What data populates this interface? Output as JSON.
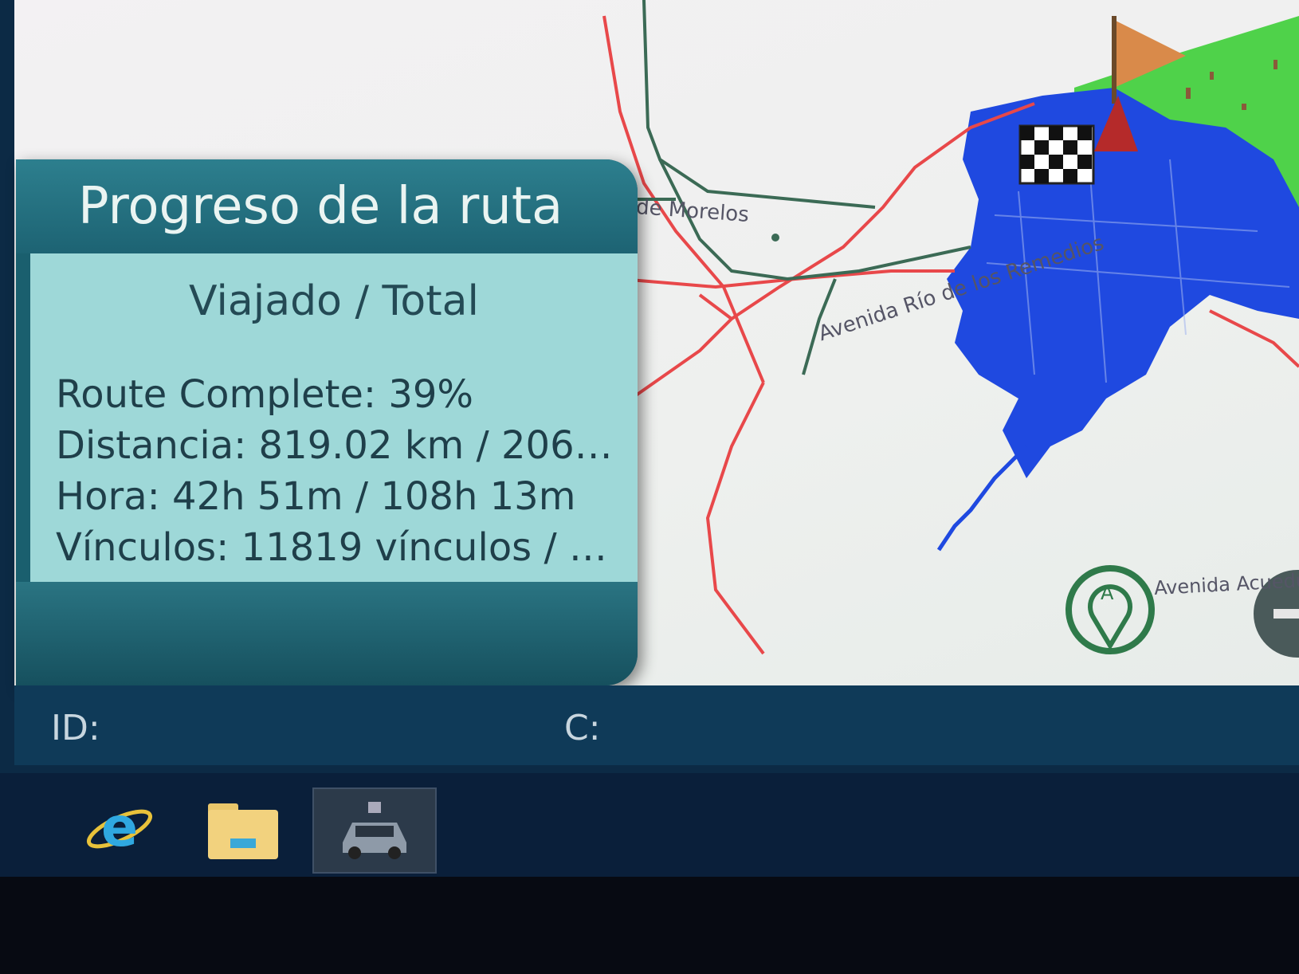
{
  "map": {
    "labels": {
      "morelos": "de Morelos",
      "avenida_rio": "Avenida Río de los Remedios",
      "acueducto": "Avenida Acueducto"
    },
    "marker_label": "A"
  },
  "route_panel": {
    "title": "Progreso de la ruta",
    "subtitle": "Viajado / Total",
    "stats": {
      "complete": "Route Complete: 39%",
      "distance": "Distancia: 819.02 km / 206…",
      "time": "Hora: 42h 51m / 108h 13m",
      "links": "Vínculos: 11819 vínculos / …"
    },
    "progress_percent": 39
  },
  "status_bar": {
    "id_label": "ID:",
    "c_label": "C:"
  },
  "taskbar": {
    "items": [
      {
        "name": "internet-explorer",
        "icon": "ie-icon"
      },
      {
        "name": "file-explorer",
        "icon": "folder-icon"
      },
      {
        "name": "vehicle-app",
        "icon": "car-icon"
      }
    ]
  },
  "colors": {
    "route_line": "#e8484a",
    "road_line": "#3b6a55",
    "covered_area": "#1f49e0",
    "zone_green": "#4fd24a",
    "panel_header": "#1d6373",
    "panel_body": "#9ed8d8"
  }
}
